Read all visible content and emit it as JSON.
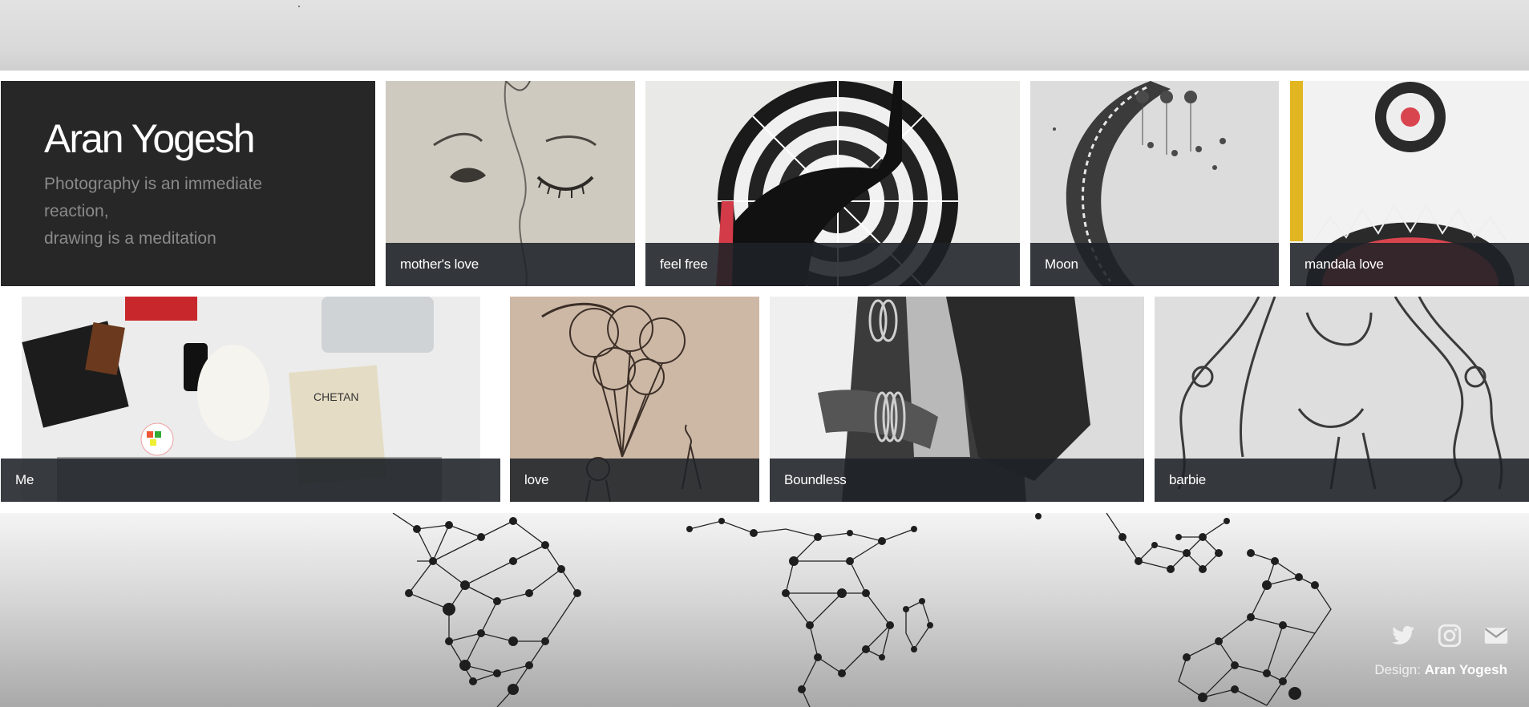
{
  "header": {
    "title": "Aran Yogesh",
    "tagline_line1": "Photography is an immediate reaction,",
    "tagline_line2": "drawing is a meditation"
  },
  "gallery": {
    "row1": [
      {
        "caption": "mother's love"
      },
      {
        "caption": "feel free"
      },
      {
        "caption": "Moon"
      },
      {
        "caption": "mandala love"
      }
    ],
    "row2": [
      {
        "caption": "Me"
      },
      {
        "caption": "love"
      },
      {
        "caption": "Boundless"
      },
      {
        "caption": "barbie"
      }
    ]
  },
  "footer": {
    "icons": [
      "twitter-icon",
      "instagram-icon",
      "mail-icon"
    ],
    "credit_label": "Design:",
    "credit_name": "Aran Yogesh"
  },
  "colors": {
    "intro_bg": "#272727",
    "caption_bg": "#1e2228",
    "accent_red": "#d9454f"
  }
}
